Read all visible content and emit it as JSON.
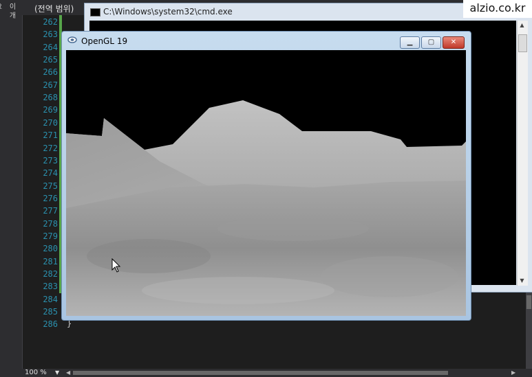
{
  "ide": {
    "side_tab": "이 개요",
    "scope_label": "(전역 범위)",
    "line_numbers": [
      "262",
      "263",
      "264",
      "265",
      "266",
      "267",
      "268",
      "269",
      "270",
      "271",
      "272",
      "273",
      "274",
      "275",
      "276",
      "277",
      "278",
      "279",
      "280",
      "281",
      "282",
      "283",
      "284",
      "285",
      "286"
    ],
    "last_line_code": "}",
    "zoom": "100 %",
    "zoom_dropdown_icon": "dropdown-arrow-icon"
  },
  "cmd_window": {
    "title": "C:\\Windows\\system32\\cmd.exe",
    "icon": "cmd-icon"
  },
  "watermark": "alzio.co.kr",
  "opengl_window": {
    "title": "OpenGL 19",
    "icon": "opengl-app-icon",
    "buttons": {
      "minimize_icon": "minimize-icon",
      "maximize_icon": "maximize-icon",
      "close_icon": "close-icon"
    },
    "scene": "terrain",
    "colors": {
      "sky": "#000000",
      "terrain_light": "#b9b9b9",
      "terrain_dark": "#8d8d8d",
      "titlebar": "#c7dcef",
      "close_button": "#c0392b"
    }
  },
  "colors": {
    "editor_bg": "#1e1e1e",
    "line_number": "#2b91af",
    "change_bar": "#57a64a"
  }
}
